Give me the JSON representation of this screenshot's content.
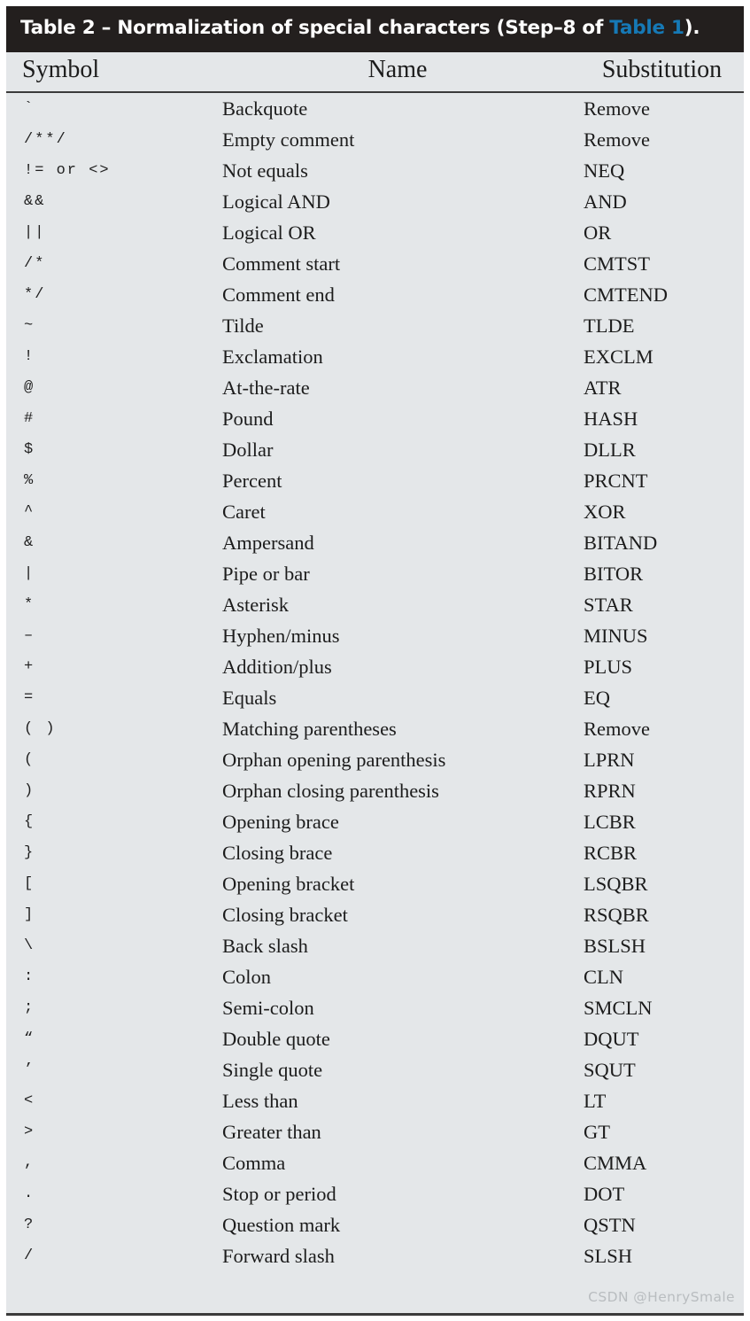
{
  "caption": {
    "prefix": "Table 2 – Normalization of special characters (Step–8 of ",
    "link_text": "Table 1",
    "suffix": ")."
  },
  "colors": {
    "caption_bg": "#231f1e",
    "caption_text": "#ffffff",
    "link": "#1679b6",
    "table_bg": "#e4e7e9",
    "rule": "#3b3b3b",
    "body_text": "#1c1c1c",
    "watermark": "#b9bdc0"
  },
  "table": {
    "columns": [
      "Symbol",
      "Name",
      "Substitution"
    ],
    "rows": [
      {
        "symbol": "`",
        "name": "Backquote",
        "substitution": "Remove"
      },
      {
        "symbol": "/**/",
        "name": "Empty comment",
        "substitution": "Remove"
      },
      {
        "symbol": "!= or <>",
        "name": "Not equals",
        "substitution": "NEQ"
      },
      {
        "symbol": "&&",
        "name": "Logical AND",
        "substitution": "AND"
      },
      {
        "symbol": "||",
        "name": "Logical OR",
        "substitution": "OR"
      },
      {
        "symbol": "/*",
        "name": "Comment start",
        "substitution": "CMTST"
      },
      {
        "symbol": "*/",
        "name": "Comment end",
        "substitution": "CMTEND"
      },
      {
        "symbol": "~",
        "name": "Tilde",
        "substitution": "TLDE"
      },
      {
        "symbol": "!",
        "name": "Exclamation",
        "substitution": "EXCLM"
      },
      {
        "symbol": "@",
        "name": "At-the-rate",
        "substitution": "ATR"
      },
      {
        "symbol": "#",
        "name": "Pound",
        "substitution": "HASH"
      },
      {
        "symbol": "$",
        "name": "Dollar",
        "substitution": "DLLR"
      },
      {
        "symbol": "%",
        "name": "Percent",
        "substitution": "PRCNT"
      },
      {
        "symbol": "^",
        "name": "Caret",
        "substitution": "XOR"
      },
      {
        "symbol": "&",
        "name": "Ampersand",
        "substitution": "BITAND"
      },
      {
        "symbol": "|",
        "name": "Pipe or bar",
        "substitution": "BITOR"
      },
      {
        "symbol": "*",
        "name": "Asterisk",
        "substitution": "STAR"
      },
      {
        "symbol": "–",
        "name": "Hyphen/minus",
        "substitution": "MINUS"
      },
      {
        "symbol": "+",
        "name": "Addition/plus",
        "substitution": "PLUS"
      },
      {
        "symbol": "=",
        "name": "Equals",
        "substitution": "EQ"
      },
      {
        "symbol": "( )",
        "name": "Matching parentheses",
        "substitution": "Remove"
      },
      {
        "symbol": "(",
        "name": "Orphan opening parenthesis",
        "substitution": "LPRN"
      },
      {
        "symbol": ")",
        "name": "Orphan closing parenthesis",
        "substitution": "RPRN"
      },
      {
        "symbol": "{",
        "name": "Opening brace",
        "substitution": "LCBR"
      },
      {
        "symbol": "}",
        "name": "Closing brace",
        "substitution": "RCBR"
      },
      {
        "symbol": "[",
        "name": "Opening bracket",
        "substitution": "LSQBR"
      },
      {
        "symbol": "]",
        "name": "Closing bracket",
        "substitution": "RSQBR"
      },
      {
        "symbol": "\\",
        "name": "Back slash",
        "substitution": "BSLSH"
      },
      {
        "symbol": ":",
        "name": "Colon",
        "substitution": "CLN"
      },
      {
        "symbol": ";",
        "name": "Semi-colon",
        "substitution": "SMCLN"
      },
      {
        "symbol": "“",
        "name": "Double quote",
        "substitution": "DQUT"
      },
      {
        "symbol": "’",
        "name": "Single quote",
        "substitution": "SQUT"
      },
      {
        "symbol": "<",
        "name": "Less than",
        "substitution": "LT"
      },
      {
        "symbol": ">",
        "name": "Greater than",
        "substitution": "GT"
      },
      {
        "symbol": ",",
        "name": "Comma",
        "substitution": "CMMA"
      },
      {
        "symbol": ".",
        "name": "Stop or period",
        "substitution": "DOT"
      },
      {
        "symbol": "?",
        "name": "Question mark",
        "substitution": "QSTN"
      },
      {
        "symbol": "/",
        "name": "Forward slash",
        "substitution": "SLSH"
      }
    ]
  },
  "watermark": "CSDN @HenrySmale"
}
